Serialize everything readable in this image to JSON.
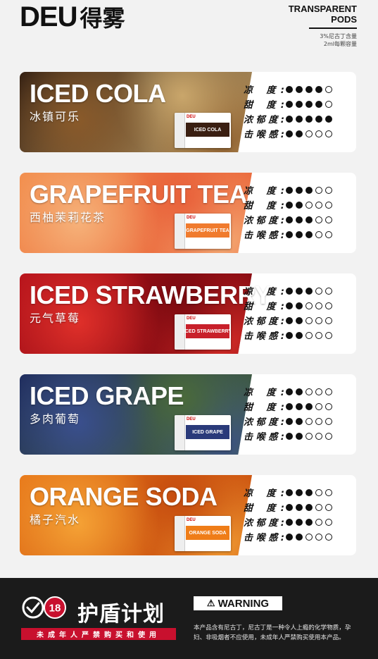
{
  "header": {
    "logo_en": "DEU",
    "logo_cn": "得雾",
    "product_line1": "TRANSPARENT",
    "product_line2": "PODS",
    "spec_line1": "3%尼古丁含量",
    "spec_line2": "2ml每颗容量"
  },
  "rating_labels": [
    "凉 度:",
    "甜 度:",
    "浓郁度:",
    "击喉感:"
  ],
  "flavors": [
    {
      "name_en": "ICED COLA",
      "name_cn": "冰镇可乐",
      "pack_label": "ICED COLA",
      "colors": [
        "#2b1a10",
        "#8a5a2a",
        "#c9a66b"
      ],
      "pack_color": "#3a1f12",
      "ratings": [
        4,
        4,
        5,
        2
      ]
    },
    {
      "name_en": "GRAPEFRUIT TEA",
      "name_cn": "西柚茉莉花茶",
      "pack_label": "GRAPEFRUIT TEA",
      "colors": [
        "#f28c4a",
        "#f6b27a",
        "#e8603a"
      ],
      "pack_color": "#f07b2e",
      "ratings": [
        3,
        2,
        3,
        3
      ]
    },
    {
      "name_en": "ICED STRAWBERRY",
      "name_cn": "元气草莓",
      "pack_label": "ICED STRAWBERRY",
      "colors": [
        "#b5121b",
        "#e0302a",
        "#7a0a10"
      ],
      "pack_color": "#c8202a",
      "ratings": [
        3,
        2,
        2,
        2
      ]
    },
    {
      "name_en": "ICED GRAPE",
      "name_cn": "多肉葡萄",
      "pack_label": "ICED GRAPE",
      "colors": [
        "#1d2a5a",
        "#3a4f8e",
        "#4a6a3a"
      ],
      "pack_color": "#2a3a7a",
      "ratings": [
        2,
        3,
        2,
        2
      ]
    },
    {
      "name_en": "ORANGE SODA",
      "name_cn": "橘子汽水",
      "pack_label": "ORANGE SODA",
      "colors": [
        "#e8781a",
        "#f5a235",
        "#c44a0e"
      ],
      "pack_color": "#ef7d18",
      "ratings": [
        3,
        3,
        3,
        2
      ]
    }
  ],
  "footer": {
    "badge_number": "18",
    "title_cn": "护盾计划",
    "minor_notice": "未成年人严禁购买和使用",
    "warning_label": "WARNING",
    "warning_text": "本产品含有尼古丁，尼古丁是一种令人上瘾的化学物质，孕妇、非吸烟者不应使用，未成年人严禁购买使用本产品。"
  }
}
